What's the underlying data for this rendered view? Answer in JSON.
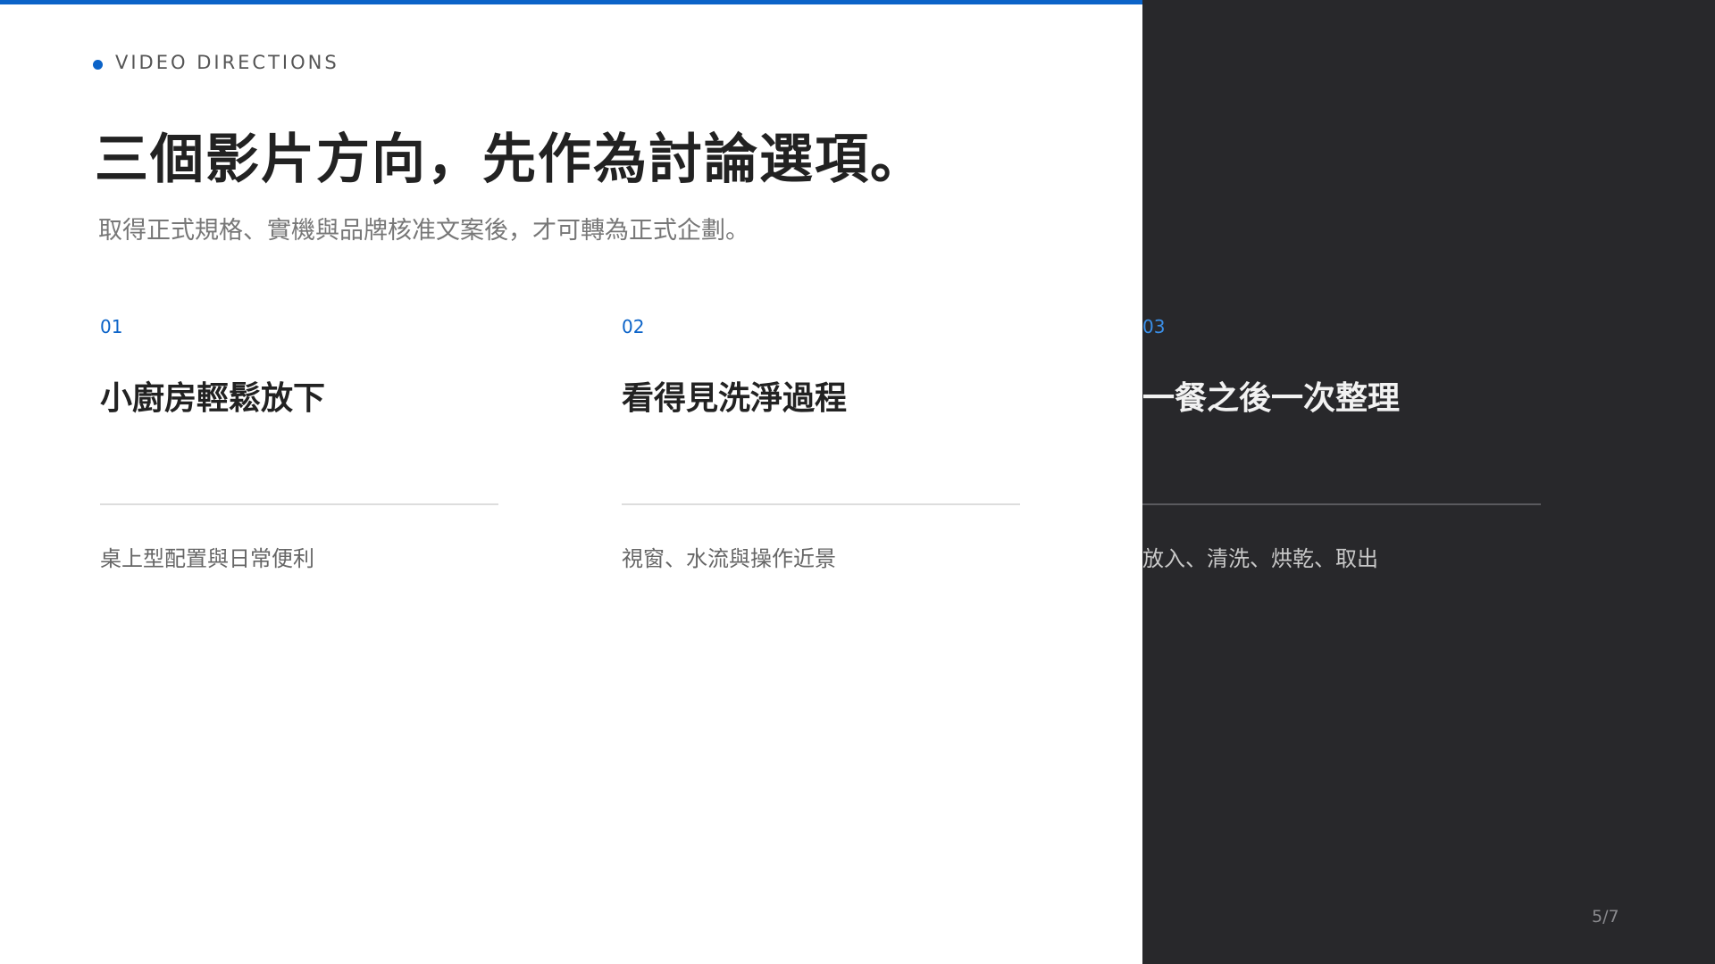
{
  "colors": {
    "accent": "#0b63c8",
    "dark_panel": "#28282b"
  },
  "eyebrow": {
    "icon": "dot-bullet-icon",
    "label": "VIDEO DIRECTIONS"
  },
  "headline": "三個影片方向，先作為討論選項。",
  "subline": "取得正式規格、實機與品牌核准文案後，才可轉為正式企劃。",
  "options": [
    {
      "number": "01",
      "title": "小廚房輕鬆放下",
      "description": "桌上型配置與日常便利"
    },
    {
      "number": "02",
      "title": "看得見洗淨過程",
      "description": "視窗、水流與操作近景"
    },
    {
      "number": "03",
      "title": "一餐之後一次整理",
      "description": "放入、清洗、烘乾、取出"
    }
  ],
  "page_indicator": "5/7"
}
